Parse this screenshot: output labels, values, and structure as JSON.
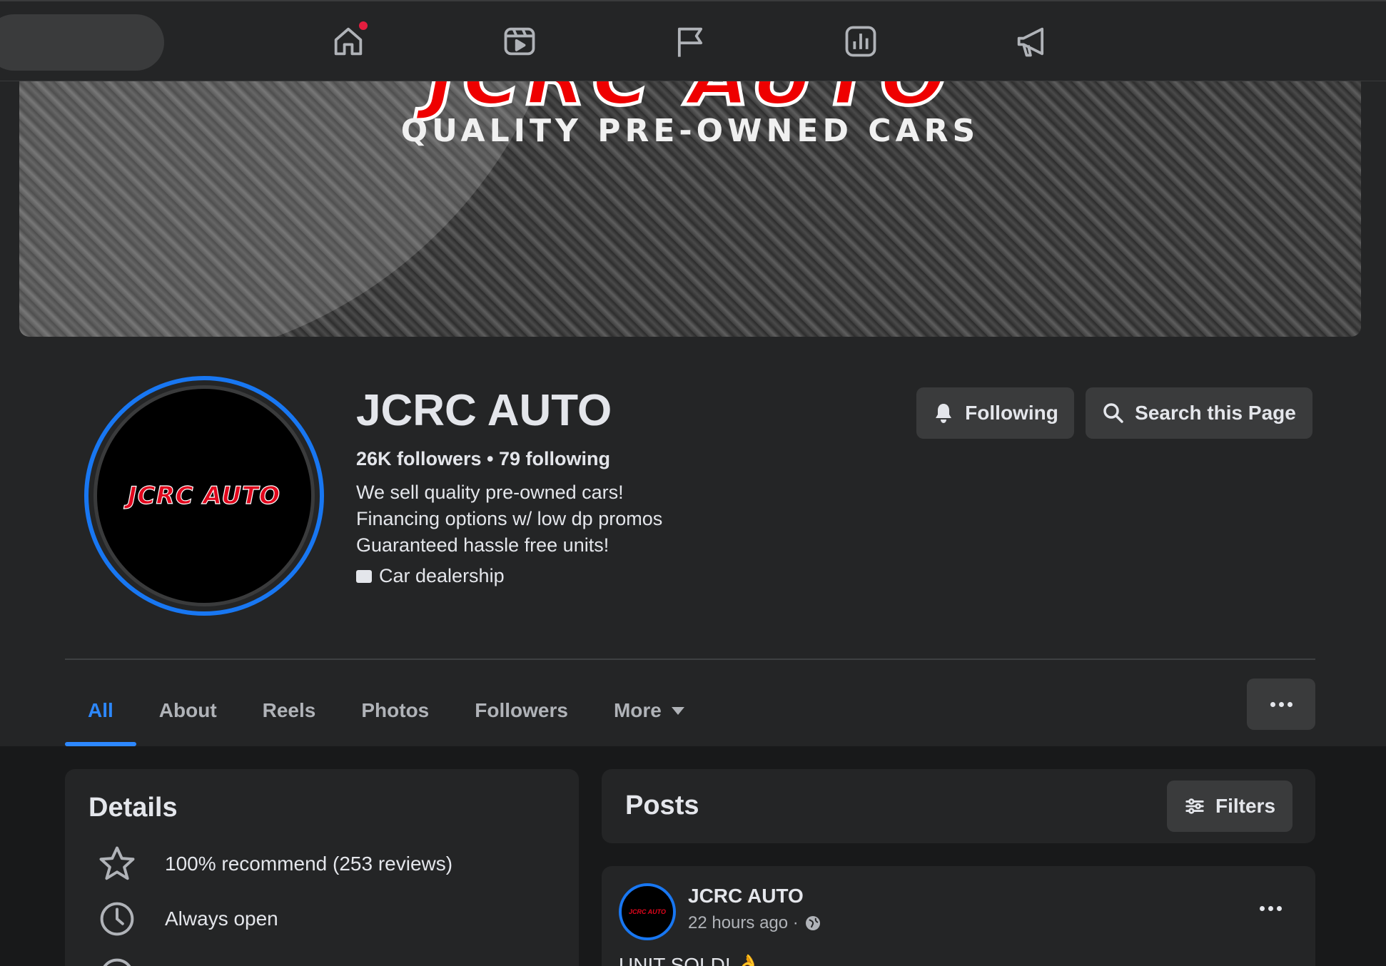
{
  "topnav": {
    "icons": [
      "home-icon",
      "video-icon",
      "flag-icon",
      "insights-icon",
      "megaphone-icon"
    ],
    "home_has_notification": true
  },
  "cover": {
    "brand": "JCRC AUTO",
    "tagline": "QUALITY PRE-OWNED CARS"
  },
  "profile": {
    "avatar_text": "JCRC AUTO",
    "name": "JCRC AUTO",
    "stats": "26K followers • 79 following",
    "bio": [
      "We sell quality pre-owned cars!",
      "Financing options w/ low dp promos",
      "Guaranteed hassle free units!"
    ],
    "category": "Car dealership"
  },
  "actions": {
    "following_label": "Following",
    "search_label": "Search this Page"
  },
  "tabs": {
    "items": [
      "All",
      "About",
      "Reels",
      "Photos",
      "Followers",
      "More"
    ],
    "active": "All"
  },
  "details": {
    "title": "Details",
    "rows": [
      "100% recommend (253 reviews)",
      "Always open"
    ]
  },
  "posts": {
    "title": "Posts",
    "filters_label": "Filters",
    "first_post": {
      "author": "JCRC AUTO",
      "avatar_text": "JCRC AUTO",
      "time": "22 hours ago ·",
      "text_start": "UNIT SOLD! 👌"
    }
  },
  "colors": {
    "accent": "#2d88ff",
    "ring": "#1877f2",
    "notification": "#e41e3f",
    "brand_red": "#e0061c"
  }
}
